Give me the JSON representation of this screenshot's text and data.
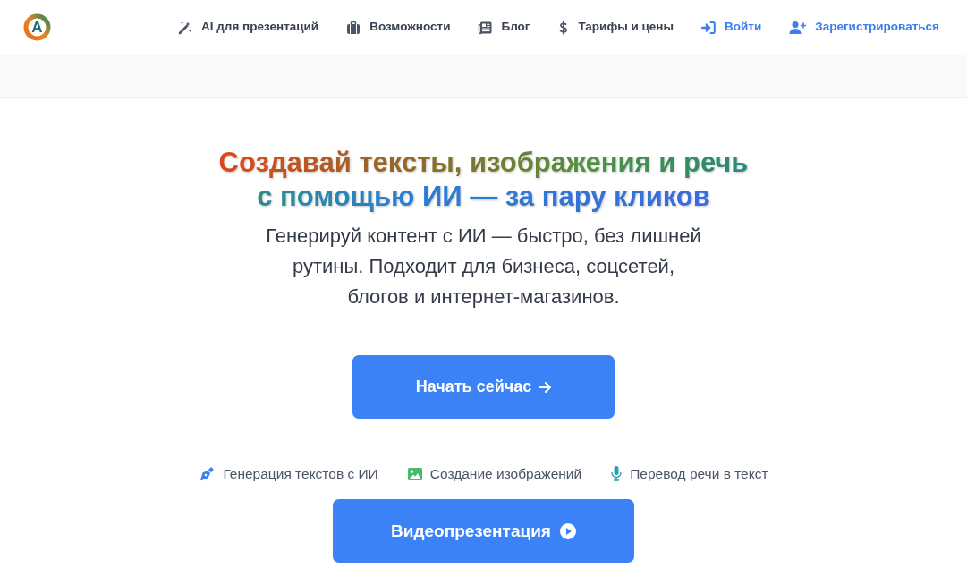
{
  "header": {
    "logo": {
      "text": "A"
    },
    "nav": [
      {
        "label": "AI для презентаций",
        "kind": "link"
      },
      {
        "label": "Возможности",
        "kind": "link"
      },
      {
        "label": "Блог",
        "kind": "link"
      },
      {
        "label": "Тарифы и цены",
        "kind": "link"
      },
      {
        "label": "Войти",
        "kind": "auth"
      },
      {
        "label": "Зарегистрироваться",
        "kind": "auth"
      }
    ]
  },
  "hero": {
    "heading": {
      "lines": [
        "Создавай тексты, изображения и речь",
        "с помощью ИИ — за пару кликов"
      ]
    },
    "subtitle": {
      "lines": [
        "Генерируй контент с ИИ — быстро, без лишней",
        "рутины. Подходит для бизнеса, соцсетей,",
        "блогов и интернет-магазинов."
      ]
    },
    "cta_button": {
      "label": "Начать сейчас"
    },
    "features": [
      {
        "label": "Генерация текстов с ИИ",
        "color": "#3b82f6"
      },
      {
        "label": "Создание изображений",
        "color": "#48bb68"
      },
      {
        "label": "Перевод речи в текст",
        "color": "#2aa0a8"
      }
    ],
    "video_button": {
      "label": "Видеопрезентация"
    }
  }
}
